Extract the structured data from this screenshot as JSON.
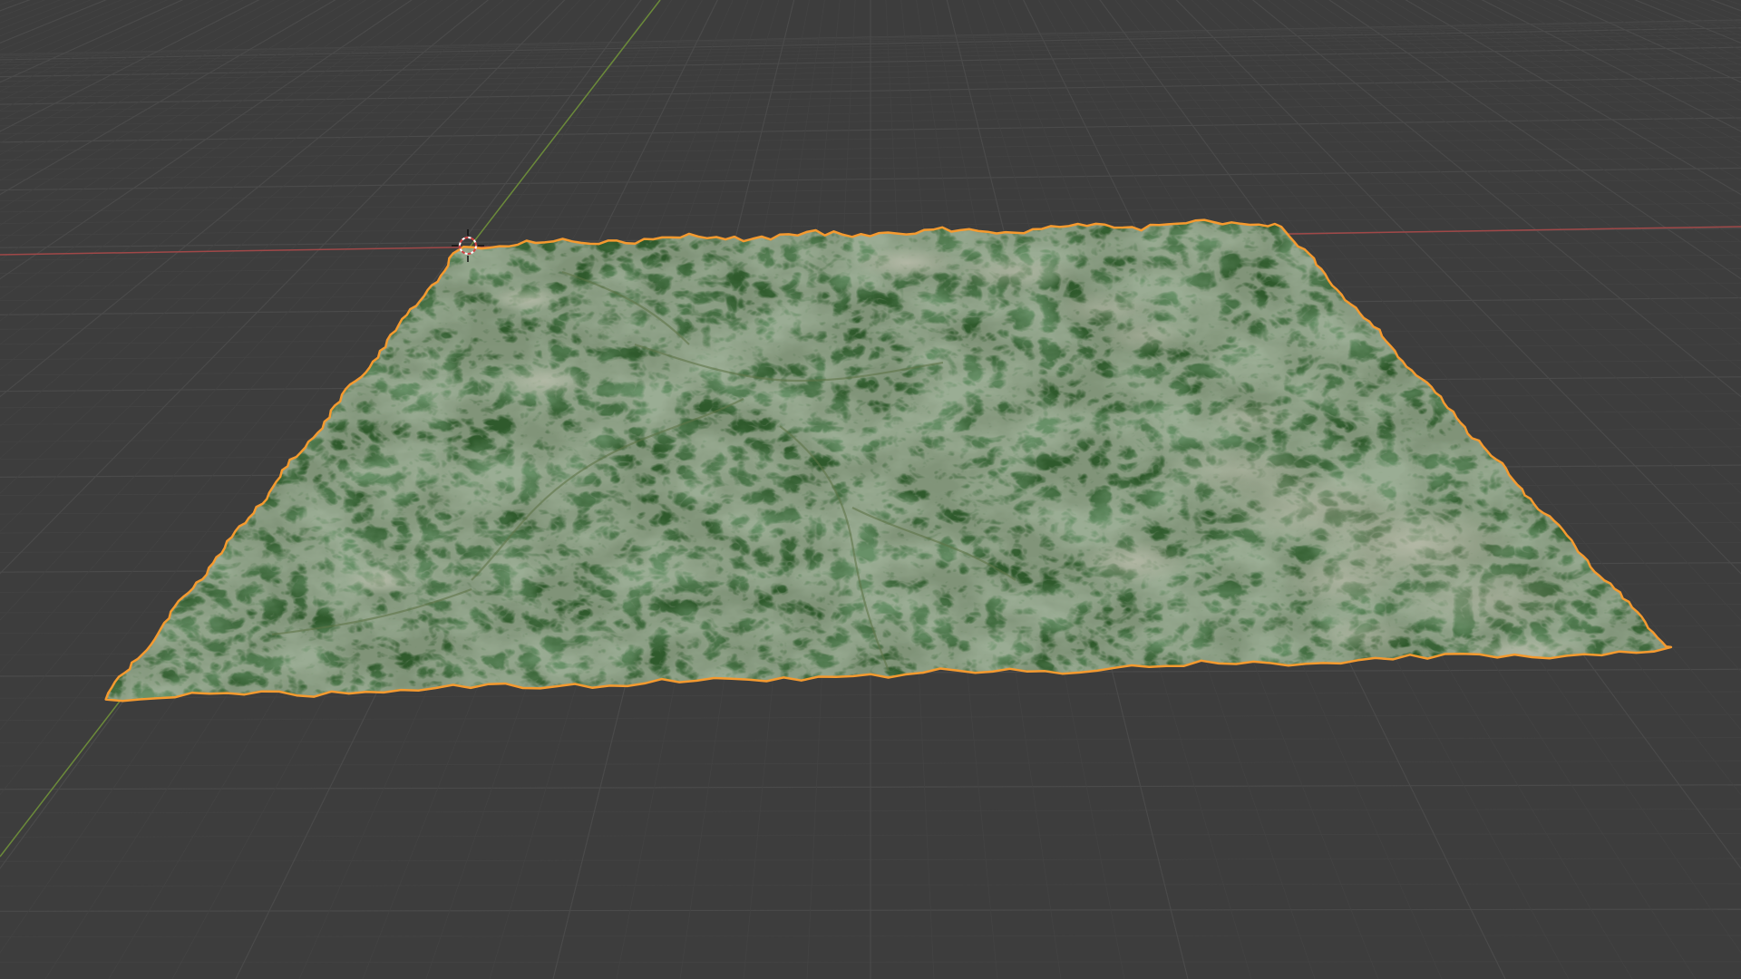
{
  "app": {
    "window_title": ""
  },
  "viewport": {
    "view_type": "3d-perspective",
    "background_color": "#3d3d3d",
    "grid_on": true,
    "grid_color": "#4a4a4a",
    "grid_subdivision_color": "#434343",
    "axes": {
      "x_axis_color": "#a04848",
      "y_axis_color": "#6b8a3a"
    },
    "selection_outline_color": "#f59a2f",
    "origin_marker": "3d-cursor-icon"
  },
  "scene": {
    "objects": [
      {
        "name": "",
        "kind": "terrain-mesh",
        "selected": true,
        "material_colors": {
          "forest": "#2f5a2c",
          "forest_dark": "#24441f",
          "valley": "#5f7448",
          "rock": "#9a9786",
          "snow": "#c9c4b6"
        }
      }
    ]
  }
}
